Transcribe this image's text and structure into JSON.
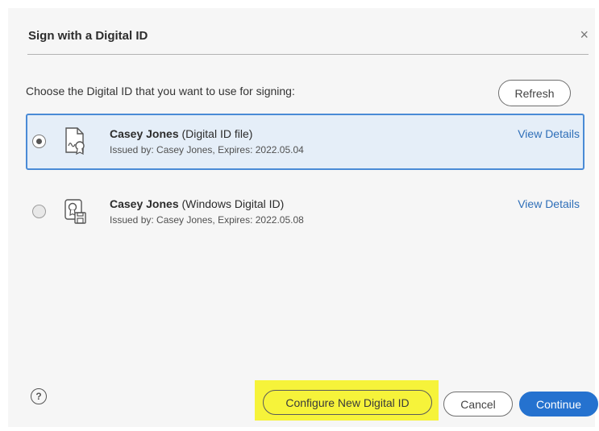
{
  "dialog": {
    "title": "Sign with a Digital ID",
    "close_glyph": "×"
  },
  "prompt": "Choose the Digital ID that you want to use for signing:",
  "refresh_label": "Refresh",
  "digital_ids": [
    {
      "name": "Casey Jones",
      "type": " (Digital ID file)",
      "issued": "Issued by: Casey Jones, Expires: 2022.05.04",
      "view_details": "View Details",
      "selected": true,
      "icon": "certificate-file-icon"
    },
    {
      "name": "Casey Jones",
      "type": " (Windows Digital ID)",
      "issued": "Issued by: Casey Jones, Expires: 2022.05.08",
      "view_details": "View Details",
      "selected": false,
      "icon": "windows-certificate-icon"
    }
  ],
  "footer": {
    "help_glyph": "?",
    "configure_label": "Configure New Digital ID",
    "cancel_label": "Cancel",
    "continue_label": "Continue"
  },
  "colors": {
    "selection_border": "#4a8bd6",
    "selection_fill": "#e5eef8",
    "link": "#2f6fb8",
    "primary_button": "#2572cf",
    "highlight": "#f6f33a"
  }
}
